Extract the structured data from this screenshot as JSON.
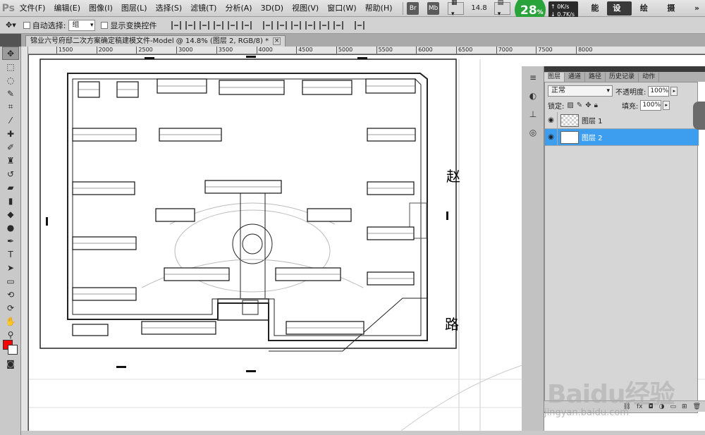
{
  "app": {
    "logo": "Ps"
  },
  "menubar": {
    "items": [
      "文件(F)",
      "编辑(E)",
      "图像(I)",
      "图层(L)",
      "选择(S)",
      "滤镜(T)",
      "分析(A)",
      "3D(D)",
      "视图(V)",
      "窗口(W)",
      "帮助(H)"
    ],
    "zoom": "14.8",
    "workspaces": {
      "partial": "能",
      "design": "设计",
      "paint": "绘画",
      "photo": "摄影",
      "more": "»"
    }
  },
  "speed": {
    "percent": "28",
    "unit": "%",
    "up": "0K/s",
    "down": "0.7K/s"
  },
  "options": {
    "auto_select_label": "自动选择:",
    "auto_select_value": "组",
    "show_transform_label": "显示变换控件"
  },
  "document": {
    "tab_title": "锦业六号府邸二次方案确定稿建模文件-Model @ 14.8% (图层 2, RGB/8) *",
    "close_symbol": "×"
  },
  "ruler_top": [
    "1500",
    "2000",
    "2500",
    "3000",
    "3500",
    "4000",
    "4500",
    "5000",
    "5500",
    "6000",
    "6500",
    "7000",
    "7500",
    "8000"
  ],
  "canvas": {
    "road_char_1": "赵",
    "road_char_2": "路"
  },
  "layers_panel": {
    "tabs": [
      "图层",
      "通道",
      "路径",
      "历史记录",
      "动作"
    ],
    "blend_mode": "正常",
    "opacity_label": "不透明度:",
    "opacity_value": "100%",
    "lock_label": "锁定:",
    "fill_label": "填充:",
    "fill_value": "100%",
    "layers": [
      {
        "name": "图层 1",
        "selected": false
      },
      {
        "name": "图层 2",
        "selected": true
      }
    ]
  },
  "watermark": {
    "text": "Baidu经验",
    "sub": "jingyan.baidu.com"
  },
  "colors": {
    "foreground": "#ff0000",
    "background": "#ffffff",
    "selected_layer": "#3d9ef0",
    "speed_green": "#2aa43a"
  }
}
